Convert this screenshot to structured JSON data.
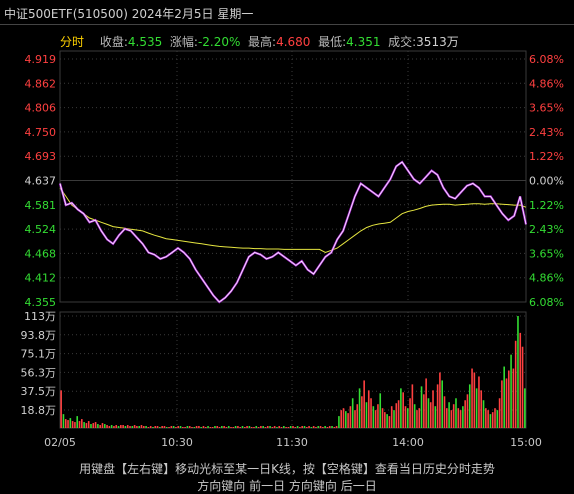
{
  "title": "中证500ETF(510500) 2024年2月5日 星期一",
  "info": {
    "mode_label": "分时",
    "close_label": "收盘:",
    "close_value": "4.535",
    "change_label": "涨幅:",
    "change_value": "-2.20%",
    "high_label": "最高:",
    "high_value": "4.680",
    "low_label": "最低:",
    "low_value": "4.351",
    "volume_label": "成交:",
    "volume_value": "3513万"
  },
  "hint": "用键盘【左右键】移动光标至某一日K线，按【空格键】查看当日历史分时走势",
  "hint2": "方向键向 前一日 方向键向 后一日",
  "colors": {
    "background": "#000000",
    "up": "#ff4040",
    "down": "#33dd33",
    "neutral": "#d0d0d0",
    "price_line": "#ffffff",
    "price_glow": "#cc33ff",
    "avg_line": "#e6e640",
    "grid": "#3a3a3a"
  },
  "chart_data": {
    "type": "line",
    "price_axis": {
      "ticks": [
        "4.919",
        "4.862",
        "4.806",
        "4.750",
        "4.693",
        "4.637",
        "4.581",
        "4.524",
        "4.468",
        "4.412",
        "4.355"
      ],
      "ylim": [
        4.355,
        4.919
      ],
      "prev_close": 4.637
    },
    "pct_axis": {
      "ticks": [
        "6.08%",
        "4.86%",
        "3.65%",
        "2.43%",
        "1.22%",
        "0.00%",
        "1.22%",
        "2.43%",
        "3.65%",
        "4.86%",
        "6.08%"
      ]
    },
    "volume_axis": {
      "ticks": [
        "113万",
        "93.8万",
        "75.1万",
        "56.3万",
        "37.5万",
        "18.8万"
      ],
      "ylim": [
        0,
        113
      ]
    },
    "x_labels": [
      "02/05",
      "10:30",
      "11:30",
      "14:00",
      "15:00"
    ],
    "series": [
      {
        "name": "price",
        "values": [
          4.63,
          4.58,
          4.585,
          4.57,
          4.56,
          4.54,
          4.545,
          4.52,
          4.5,
          4.49,
          4.51,
          4.525,
          4.52,
          4.505,
          4.49,
          4.47,
          4.465,
          4.455,
          4.46,
          4.47,
          4.48,
          4.47,
          4.455,
          4.43,
          4.41,
          4.39,
          4.37,
          4.355,
          4.365,
          4.38,
          4.4,
          4.43,
          4.46,
          4.47,
          4.465,
          4.455,
          4.46,
          4.47,
          4.46,
          4.45,
          4.44,
          4.45,
          4.43,
          4.42,
          4.44,
          4.46,
          4.47,
          4.5,
          4.52,
          4.56,
          4.6,
          4.63,
          4.62,
          4.61,
          4.6,
          4.62,
          4.64,
          4.67,
          4.68,
          4.66,
          4.64,
          4.63,
          4.645,
          4.66,
          4.65,
          4.62,
          4.6,
          4.595,
          4.61,
          4.625,
          4.63,
          4.62,
          4.6,
          4.6,
          4.58,
          4.56,
          4.545,
          4.555,
          4.6,
          4.535
        ]
      },
      {
        "name": "average",
        "values": [
          4.62,
          4.6,
          4.58,
          4.57,
          4.56,
          4.55,
          4.545,
          4.54,
          4.535,
          4.53,
          4.528,
          4.526,
          4.524,
          4.522,
          4.52,
          4.515,
          4.51,
          4.506,
          4.502,
          4.5,
          4.498,
          4.496,
          4.494,
          4.492,
          4.49,
          4.488,
          4.486,
          4.484,
          4.483,
          4.482,
          4.481,
          4.48,
          4.48,
          4.479,
          4.479,
          4.478,
          4.478,
          4.478,
          4.477,
          4.477,
          4.477,
          4.477,
          4.477,
          4.477,
          4.477,
          4.47,
          4.475,
          4.48,
          4.49,
          4.5,
          4.51,
          4.52,
          4.528,
          4.533,
          4.536,
          4.538,
          4.54,
          4.55,
          4.56,
          4.565,
          4.568,
          4.572,
          4.577,
          4.58,
          4.581,
          4.582,
          4.582,
          4.58,
          4.581,
          4.582,
          4.583,
          4.583,
          4.582,
          4.583,
          4.583,
          4.582,
          4.581,
          4.58,
          4.58,
          4.575
        ]
      }
    ],
    "volume": [
      38,
      14,
      9,
      8,
      10,
      7,
      6,
      12,
      7,
      9,
      6,
      5,
      7,
      4,
      5,
      6,
      4,
      3,
      5,
      4,
      3,
      2,
      3,
      2,
      3,
      2,
      3,
      3,
      2,
      3,
      2,
      2,
      3,
      2,
      2,
      3,
      2,
      2,
      1,
      2,
      1,
      2,
      2,
      1,
      2,
      2,
      1,
      1,
      2,
      2,
      1,
      2,
      2,
      1,
      1,
      2,
      2,
      1,
      1,
      2,
      2,
      1,
      2,
      1,
      2,
      1,
      1,
      2,
      2,
      1,
      2,
      2,
      1,
      2,
      1,
      1,
      2,
      2,
      1,
      2,
      1,
      2,
      2,
      1,
      1,
      2,
      1,
      2,
      2,
      1,
      2,
      2,
      1,
      2,
      1,
      2,
      1,
      2,
      1,
      1,
      2,
      2,
      1,
      2,
      1,
      2,
      2,
      1,
      2,
      1,
      2,
      1,
      2,
      2,
      1,
      2,
      1,
      2,
      2,
      1,
      2,
      12,
      18,
      20,
      17,
      15,
      22,
      30,
      18,
      24,
      40,
      32,
      48,
      26,
      38,
      30,
      22,
      18,
      24,
      35,
      20,
      16,
      14,
      12,
      22,
      18,
      25,
      28,
      40,
      36,
      22,
      20,
      30,
      44,
      24,
      18,
      20,
      42,
      34,
      50,
      30,
      26,
      38,
      22,
      44,
      56,
      48,
      32,
      20,
      26,
      18,
      24,
      30,
      20,
      18,
      22,
      28,
      34,
      44,
      60,
      56,
      40,
      52,
      38,
      28,
      20,
      18,
      14,
      16,
      20,
      18,
      30,
      48,
      62,
      50,
      58,
      74,
      60,
      88,
      113,
      96,
      82,
      40
    ],
    "volume_colors": "mixed red/green per minute"
  }
}
